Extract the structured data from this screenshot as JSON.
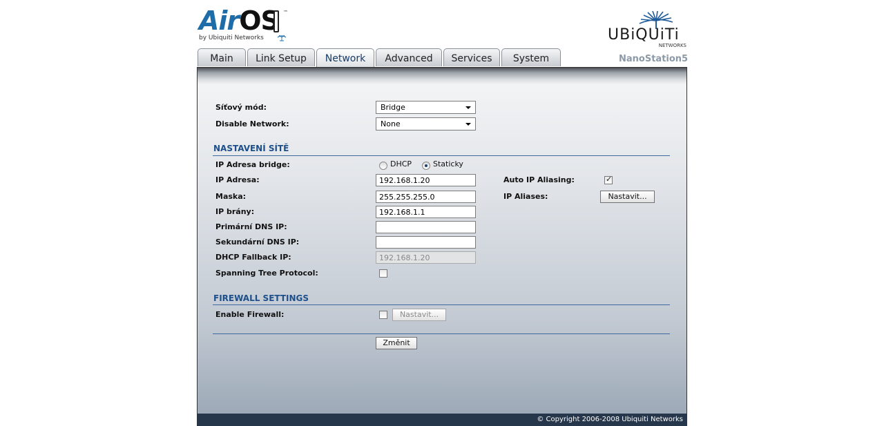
{
  "brand": {
    "airos_air": "Air",
    "airos_os": "OS",
    "airos_tm": "™",
    "airos_by": "by Ubiquiti Networks",
    "ubnt": "UBiQUiTi",
    "ubnt_sub": "NETWORKS"
  },
  "device_name": "NanoStation5",
  "tabs": [
    {
      "label": "Main"
    },
    {
      "label": "Link Setup"
    },
    {
      "label": "Network",
      "active": true
    },
    {
      "label": "Advanced"
    },
    {
      "label": "Services"
    },
    {
      "label": "System"
    }
  ],
  "network_mode": {
    "label": "Síťový mód:",
    "value": "Bridge"
  },
  "disable_network": {
    "label": "Disable Network:",
    "value": "None"
  },
  "network_settings": {
    "title": "NASTAVENÍ SÍTĚ",
    "ip_bridge_label": "IP Adresa bridge:",
    "dhcp_label": "DHCP",
    "static_label": "Staticky",
    "selected": "static",
    "ip_label": "IP Adresa:",
    "ip_value": "192.168.1.20",
    "mask_label": "Maska:",
    "mask_value": "255.255.255.0",
    "gateway_label": "IP brány:",
    "gateway_value": "192.168.1.1",
    "dns1_label": "Primární DNS IP:",
    "dns1_value": "",
    "dns2_label": "Sekundární DNS IP:",
    "dns2_value": "",
    "fallback_label": "DHCP Fallback IP:",
    "fallback_value": "192.168.1.20",
    "stp_label": "Spanning Tree Protocol:",
    "stp_checked": false,
    "auto_alias_label": "Auto IP Aliasing:",
    "auto_alias_checked": true,
    "aliases_label": "IP Aliases:",
    "aliases_button": "Nastavit..."
  },
  "firewall": {
    "title": "FIREWALL SETTINGS",
    "enable_label": "Enable Firewall:",
    "enabled": false,
    "configure_button": "Nastavit..."
  },
  "apply_button": "Změnit",
  "footer": "© Copyright 2006-2008 Ubiquiti Networks"
}
